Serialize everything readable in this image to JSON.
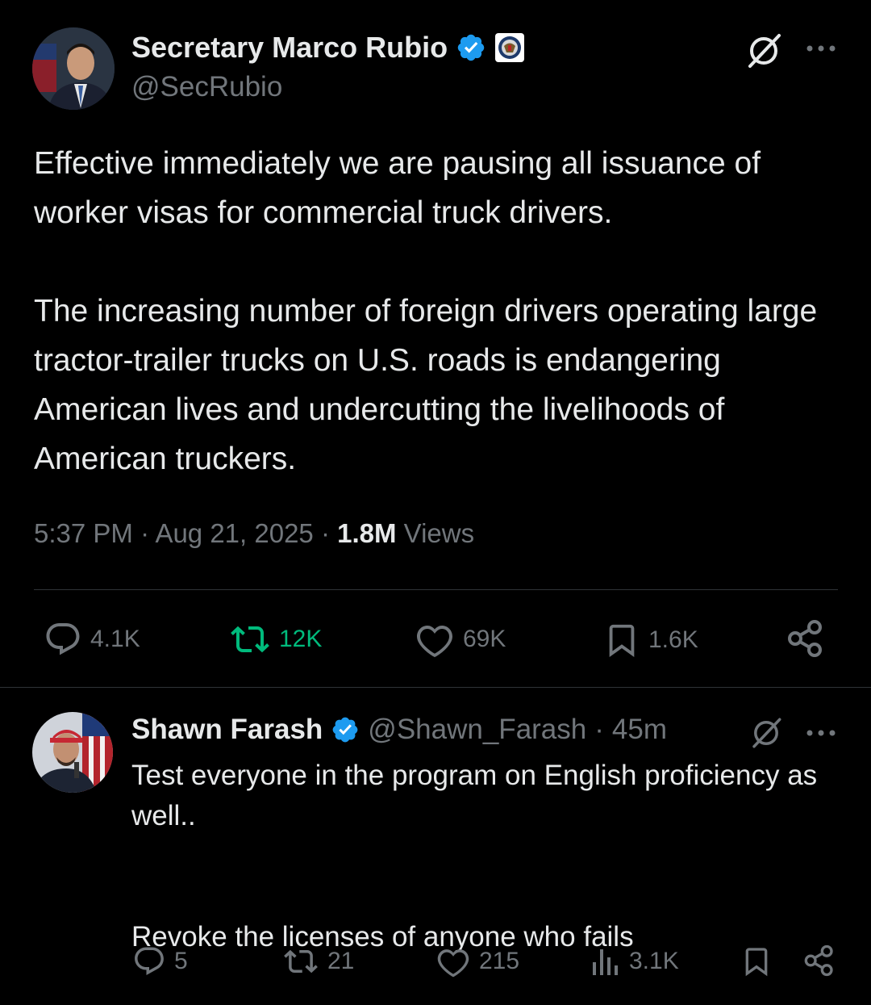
{
  "main_post": {
    "author_name": "Secretary Marco Rubio",
    "handle": "@SecRubio",
    "text": "Effective immediately we are pausing all issuance of worker visas for commercial truck drivers.\n\nThe increasing number of foreign drivers operating large tractor-trailer trucks on U.S. roads is endangering American lives and undercutting the livelihoods of American truckers.",
    "time": "5:37 PM",
    "date": "Aug 21, 2025",
    "views_count": "1.8M",
    "views_label": "Views",
    "stats": {
      "replies": "4.1K",
      "reposts": "12K",
      "likes": "69K",
      "bookmarks": "1.6K"
    }
  },
  "reply": {
    "author_name": "Shawn Farash",
    "handle": "@Shawn_Farash",
    "age": "45m",
    "text": "Test everyone in the program on English proficiency as well..\n\n\nRevoke the licenses of anyone who fails",
    "stats": {
      "replies": "5",
      "reposts": "21",
      "likes": "215",
      "views": "3.1K"
    }
  },
  "colors": {
    "background": "#000000",
    "text": "#e7e9ea",
    "muted": "#71767b",
    "verified": "#1d9bf0",
    "repost_active": "#00ba7c",
    "divider": "#2f3336"
  },
  "separator": "·",
  "icons": [
    "verified-badge-icon",
    "state-dept-seal-icon",
    "grok-icon",
    "more-icon",
    "reply-icon",
    "repost-icon",
    "like-icon",
    "bookmark-icon",
    "share-icon",
    "views-icon"
  ]
}
